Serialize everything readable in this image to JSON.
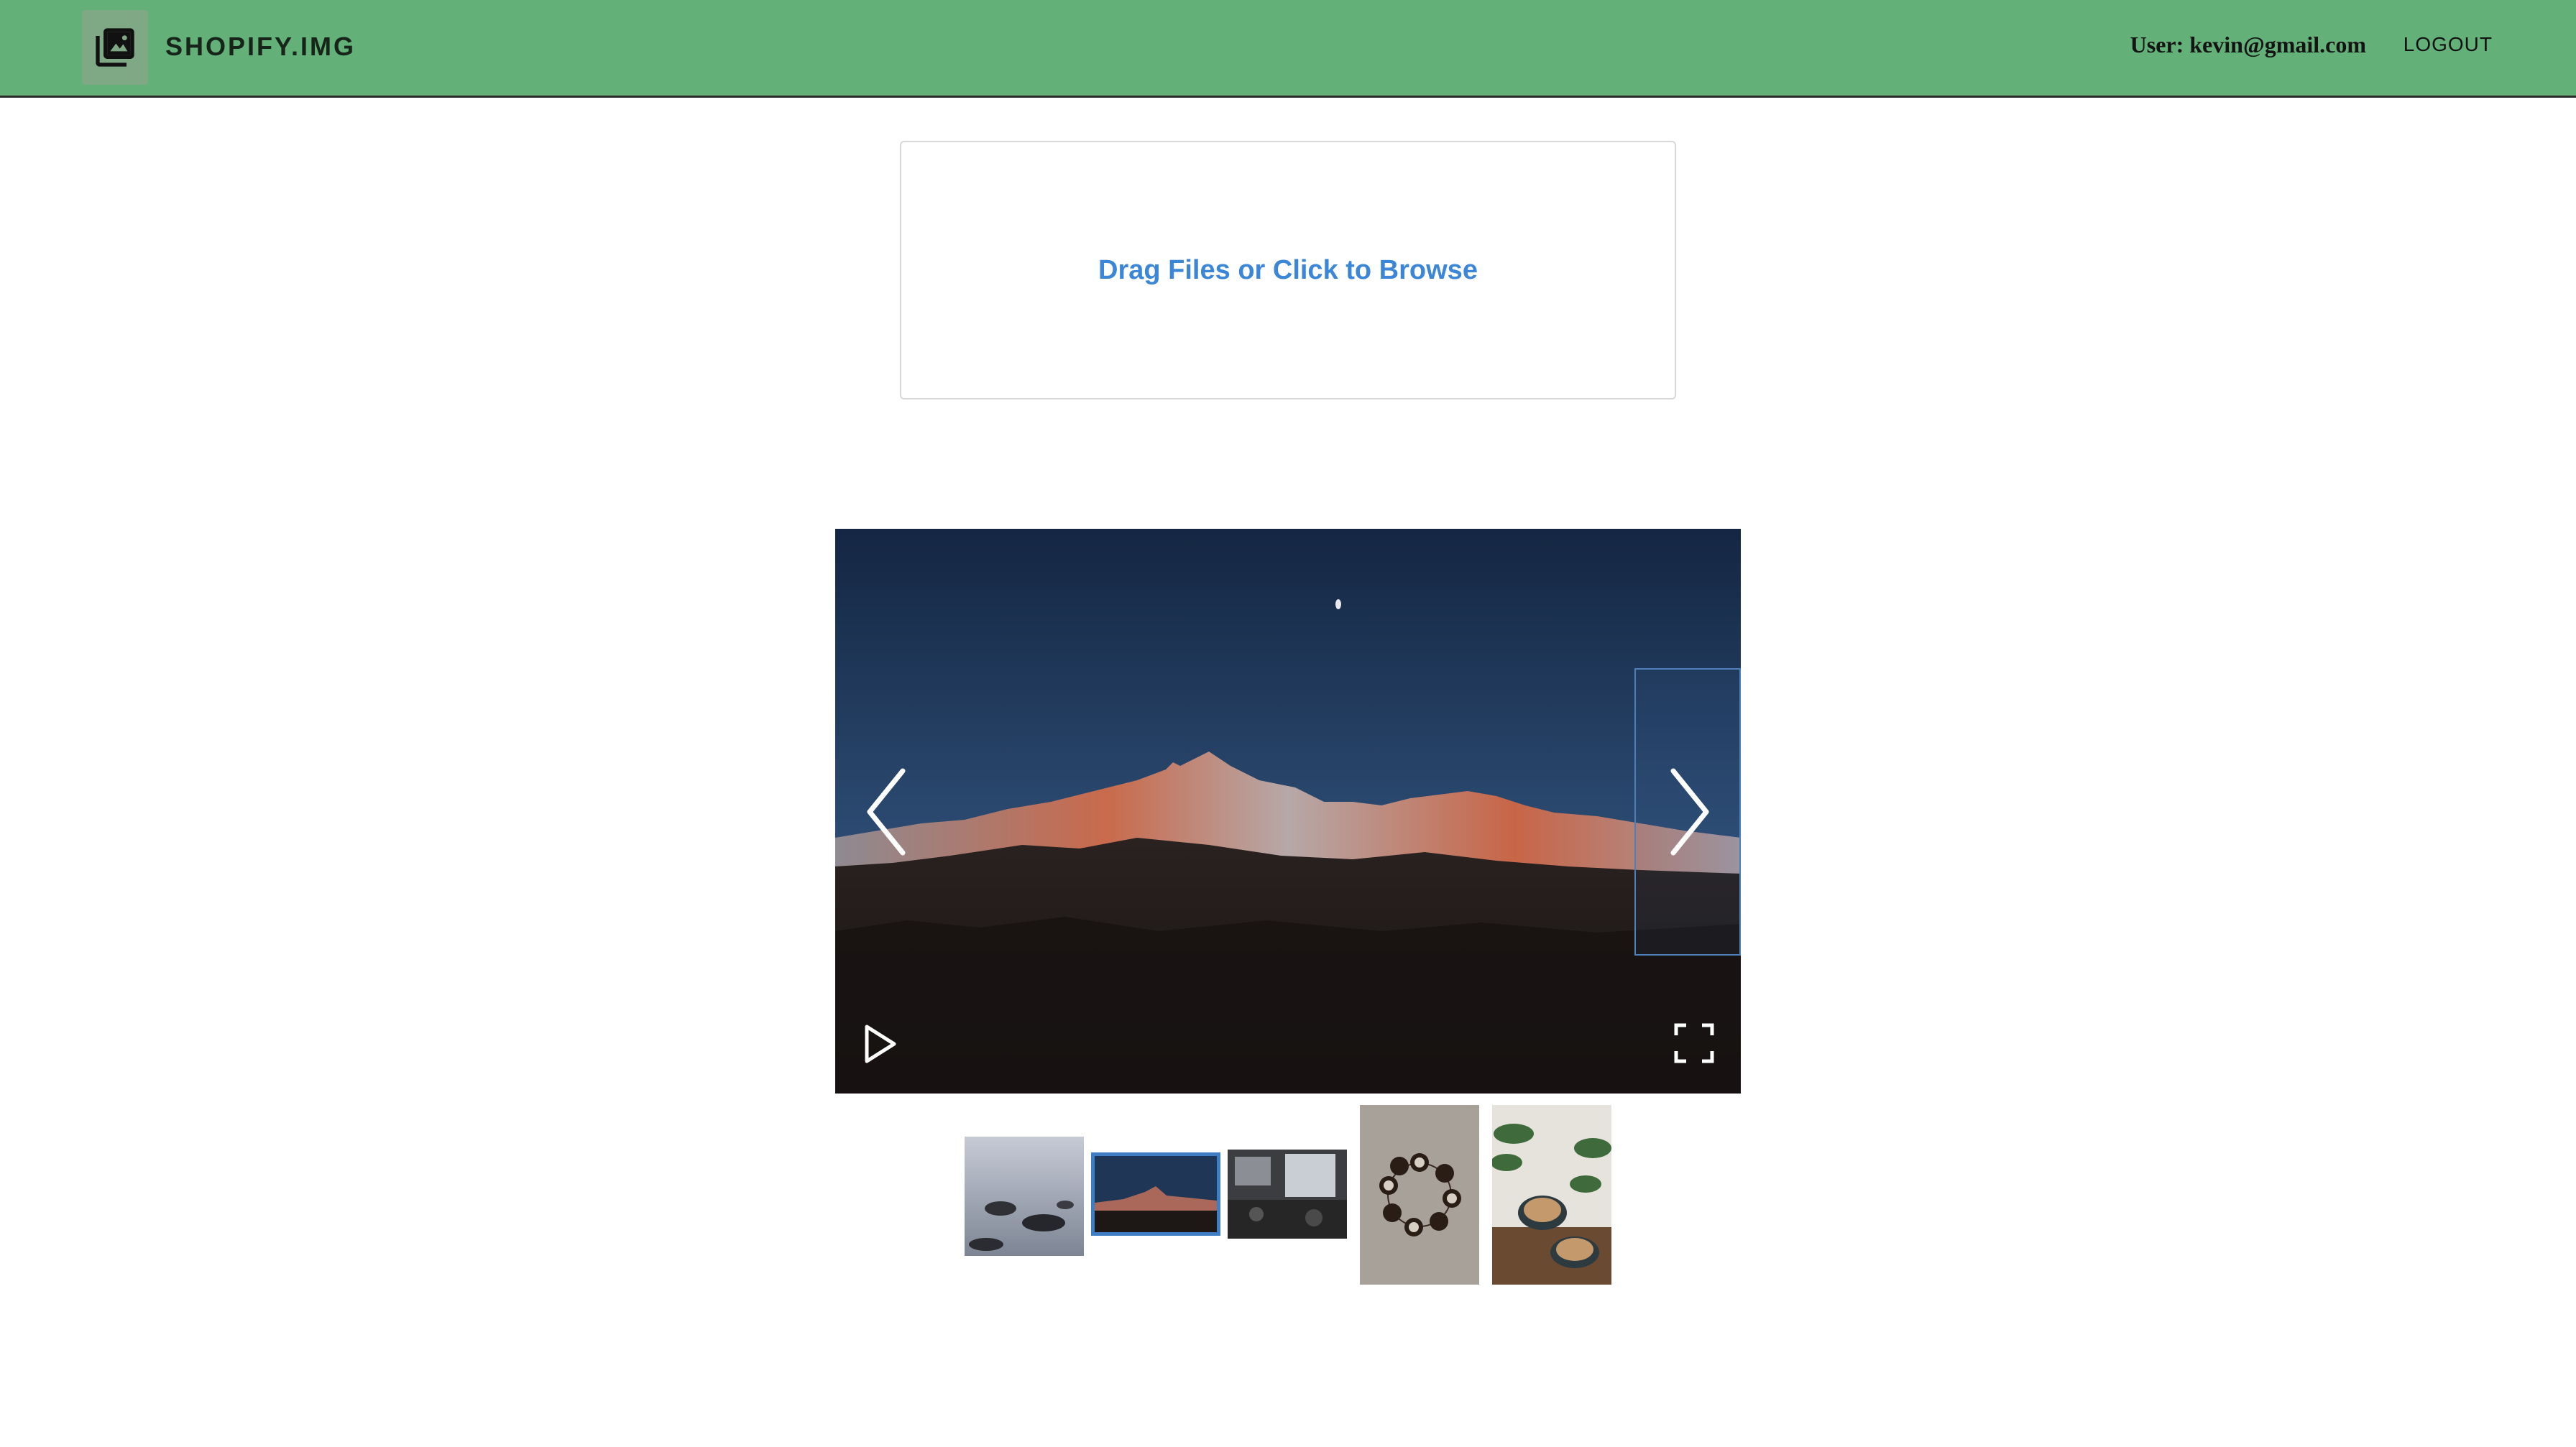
{
  "app": {
    "brand": "SHOPIFY.IMG",
    "user_label": "User: kevin@gmail.com",
    "logout_label": "LOGOUT"
  },
  "dropzone": {
    "label": "Drag Files or Click to Browse"
  },
  "gallery": {
    "active_index": 1,
    "thumbnail_count": 5,
    "controls": {
      "prev_icon": "chevron-left-icon",
      "next_icon": "chevron-right-icon",
      "play_icon": "play-icon",
      "fullscreen_icon": "fullscreen-icon"
    },
    "thumbnails": [
      {
        "subject": "misty sea rocks"
      },
      {
        "subject": "mountain range at dusk"
      },
      {
        "subject": "cafe interior"
      },
      {
        "subject": "coffee cups circle top view"
      },
      {
        "subject": "latte cups with plants"
      }
    ]
  },
  "colors": {
    "appbar": "#63b179",
    "link_blue": "#3c86d8",
    "active_thumb_border": "#3f7ec4"
  }
}
